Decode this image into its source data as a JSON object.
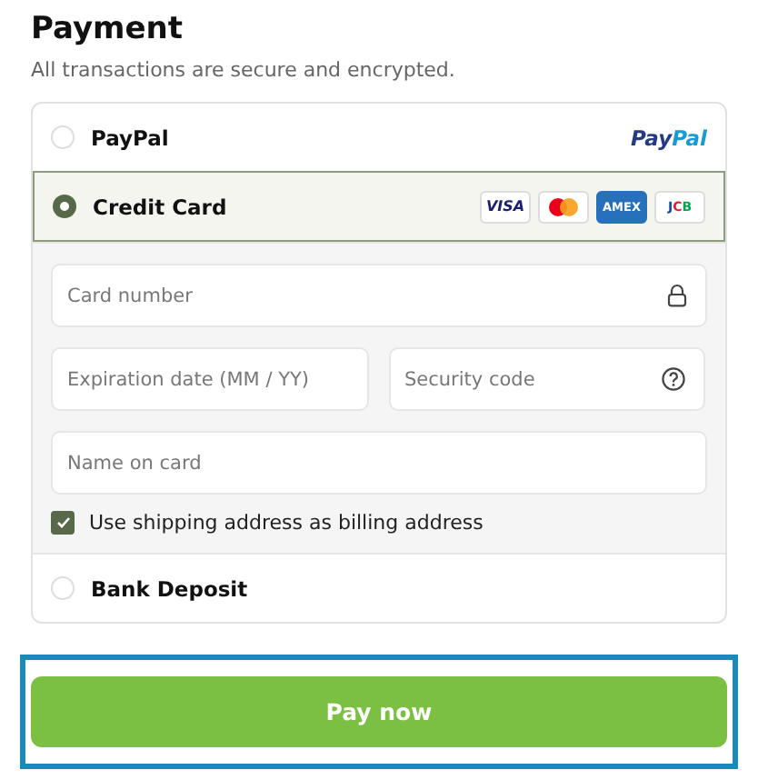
{
  "title": "Payment",
  "subtitle": "All transactions are secure and encrypted.",
  "methods": [
    {
      "label": "PayPal",
      "selected": false,
      "kind": "paypal",
      "logo": {
        "first": "Pay",
        "second": "Pal"
      }
    },
    {
      "label": "Credit Card",
      "selected": true,
      "kind": "card",
      "logos": [
        {
          "kind": "visa",
          "text": "VISA"
        },
        {
          "kind": "mastercard"
        },
        {
          "kind": "amex",
          "text": "AMEX"
        },
        {
          "kind": "jcb",
          "text": "JCB"
        }
      ],
      "fields": [
        {
          "kind": "number",
          "placeholder": "Card number"
        },
        {
          "kind": "expiry",
          "placeholder": "Expiration date (MM / YY)"
        },
        {
          "kind": "cvc",
          "placeholder": "Security code"
        },
        {
          "kind": "name",
          "placeholder": "Name on card"
        }
      ],
      "billing_checkbox": {
        "label": "Use shipping address as billing address",
        "checked": true
      }
    },
    {
      "label": "Bank Deposit",
      "selected": false,
      "kind": "plain"
    }
  ],
  "pay_button": {
    "label": "Pay now",
    "focused": true
  }
}
